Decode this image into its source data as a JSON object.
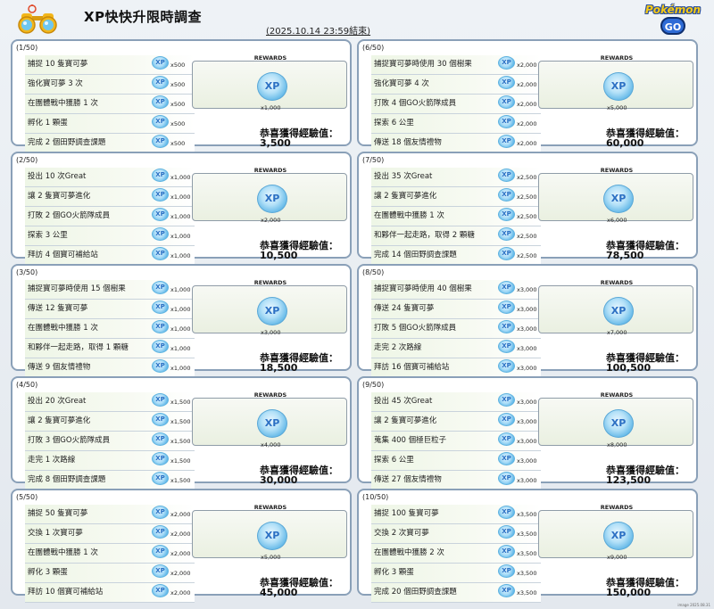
{
  "header": {
    "title": "XP快快升限時調查",
    "date": "(2025.10.14 23:59結束)"
  },
  "rewards_label": "REWARDS",
  "total_label": "恭喜獲得經驗值：",
  "stages": [
    {
      "num": "(1/50)",
      "tasks": [
        {
          "name": "捕捉 10 隻寶可夢",
          "xp": "x500"
        },
        {
          "name": "強化寶可夢 3 次",
          "xp": "x500"
        },
        {
          "name": "在團體戰中獲勝 1 次",
          "xp": "x500"
        },
        {
          "name": "孵化 1 顆蛋",
          "xp": "x500"
        },
        {
          "name": "完成 2 個田野調查課題",
          "xp": "x500"
        }
      ],
      "reward": "x1,000",
      "total": "3,500"
    },
    {
      "num": "(2/50)",
      "tasks": [
        {
          "name": "投出 10 次Great",
          "xp": "x1,000"
        },
        {
          "name": "讓 2 隻寶可夢進化",
          "xp": "x1,000"
        },
        {
          "name": "打敗 2 個GO火箭隊成員",
          "xp": "x1,000"
        },
        {
          "name": "探索 3 公里",
          "xp": "x1,000"
        },
        {
          "name": "拜訪 4 個寶可補給站",
          "xp": "x1,000"
        }
      ],
      "reward": "x2,000",
      "total": "10,500"
    },
    {
      "num": "(3/50)",
      "tasks": [
        {
          "name": "捕捉寶可夢時使用 15 個樹果",
          "xp": "x1,000"
        },
        {
          "name": "傳送 12 隻寶可夢",
          "xp": "x1,000"
        },
        {
          "name": "在團體戰中獲勝 1 次",
          "xp": "x1,000"
        },
        {
          "name": "和夥伴一起走路，取得 1 顆糖",
          "xp": "x1,000"
        },
        {
          "name": "傳送 9 個友情禮物",
          "xp": "x1,000"
        }
      ],
      "reward": "x3,000",
      "total": "18,500"
    },
    {
      "num": "(4/50)",
      "tasks": [
        {
          "name": "投出 20 次Great",
          "xp": "x1,500"
        },
        {
          "name": "讓 2 隻寶可夢進化",
          "xp": "x1,500"
        },
        {
          "name": "打敗 3 個GO火箭隊成員",
          "xp": "x1,500"
        },
        {
          "name": "走完 1 次路線",
          "xp": "x1,500"
        },
        {
          "name": "完成 8 個田野調查課題",
          "xp": "x1,500"
        }
      ],
      "reward": "x4,000",
      "total": "30,000"
    },
    {
      "num": "(5/50)",
      "tasks": [
        {
          "name": "捕捉 50 隻寶可夢",
          "xp": "x2,000"
        },
        {
          "name": "交換 1 次寶可夢",
          "xp": "x2,000"
        },
        {
          "name": "在團體戰中獲勝 1 次",
          "xp": "x2,000"
        },
        {
          "name": "孵化 3 顆蛋",
          "xp": "x2,000"
        },
        {
          "name": "拜訪 10 個寶可補給站",
          "xp": "x2,000"
        }
      ],
      "reward": "x5,000",
      "total": "45,000"
    },
    {
      "num": "(6/50)",
      "tasks": [
        {
          "name": "捕捉寶可夢時使用 30 個樹果",
          "xp": "x2,000"
        },
        {
          "name": "強化寶可夢 4 次",
          "xp": "x2,000"
        },
        {
          "name": "打敗 4 個GO火箭隊成員",
          "xp": "x2,000"
        },
        {
          "name": "探索 6 公里",
          "xp": "x2,000"
        },
        {
          "name": "傳送 18 個友情禮物",
          "xp": "x2,000"
        }
      ],
      "reward": "x5,000",
      "total": "60,000"
    },
    {
      "num": "(7/50)",
      "tasks": [
        {
          "name": "投出 35 次Great",
          "xp": "x2,500"
        },
        {
          "name": "讓 2 隻寶可夢進化",
          "xp": "x2,500"
        },
        {
          "name": "在團體戰中獲勝 1 次",
          "xp": "x2,500"
        },
        {
          "name": "和夥伴一起走路，取得 2 顆糖",
          "xp": "x2,500"
        },
        {
          "name": "完成 14 個田野調查課題",
          "xp": "x2,500"
        }
      ],
      "reward": "x6,000",
      "total": "78,500"
    },
    {
      "num": "(8/50)",
      "tasks": [
        {
          "name": "捕捉寶可夢時使用 40 個樹果",
          "xp": "x3,000"
        },
        {
          "name": "傳送 24 隻寶可夢",
          "xp": "x3,000"
        },
        {
          "name": "打敗 5 個GO火箭隊成員",
          "xp": "x3,000"
        },
        {
          "name": "走完 2 次路線",
          "xp": "x3,000"
        },
        {
          "name": "拜訪 16 個寶可補給站",
          "xp": "x3,000"
        }
      ],
      "reward": "x7,000",
      "total": "100,500"
    },
    {
      "num": "(9/50)",
      "tasks": [
        {
          "name": "投出 45 次Great",
          "xp": "x3,000"
        },
        {
          "name": "讓 2 隻寶可夢進化",
          "xp": "x3,000"
        },
        {
          "name": "蒐集 400 個極巨粒子",
          "xp": "x3,000"
        },
        {
          "name": "探索 6 公里",
          "xp": "x3,000"
        },
        {
          "name": "傳送 27 個友情禮物",
          "xp": "x3,000"
        }
      ],
      "reward": "x8,000",
      "total": "123,500"
    },
    {
      "num": "(10/50)",
      "tasks": [
        {
          "name": "捕捉 100 隻寶可夢",
          "xp": "x3,500"
        },
        {
          "name": "交換 2 次寶可夢",
          "xp": "x3,500"
        },
        {
          "name": "在團體戰中獲勝 2 次",
          "xp": "x3,500"
        },
        {
          "name": "孵化 3 顆蛋",
          "xp": "x3,500"
        },
        {
          "name": "完成 20 個田野調查課題",
          "xp": "x3,500"
        }
      ],
      "reward": "x9,000",
      "total": "150,000"
    }
  ],
  "logo": {
    "brand": "Pokémon",
    "sub": "GO"
  },
  "xp_icon_text": "XP",
  "footer": "image 2025.08.31"
}
